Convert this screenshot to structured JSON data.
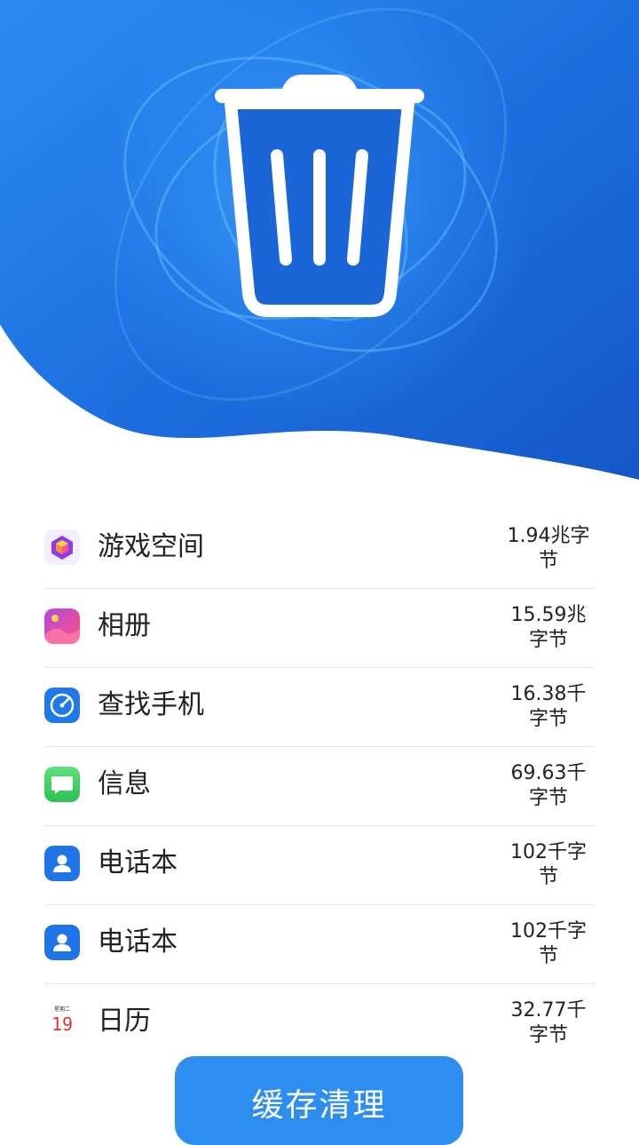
{
  "hero": {
    "icon": "trash-can-icon",
    "background_color": "#1e6fdf"
  },
  "items": [
    {
      "name": "游戏空间",
      "size": "1.94兆字节",
      "icon": "game-space-icon"
    },
    {
      "name": "相册",
      "size": "15.59兆字节",
      "icon": "gallery-icon"
    },
    {
      "name": "查找手机",
      "size": "16.38千字节",
      "icon": "find-phone-icon"
    },
    {
      "name": "信息",
      "size": "69.63千字节",
      "icon": "messages-icon"
    },
    {
      "name": "电话本",
      "size": "102千字节",
      "icon": "contacts-icon"
    },
    {
      "name": "电话本",
      "size": "102千字节",
      "icon": "contacts-icon"
    },
    {
      "name": "日历",
      "size": "32.77千字节",
      "icon": "calendar-icon",
      "calendar_day": "19",
      "calendar_weekday": "星期二"
    }
  ],
  "clean_button": {
    "label": "缓存清理",
    "color": "#2d8ef0"
  }
}
